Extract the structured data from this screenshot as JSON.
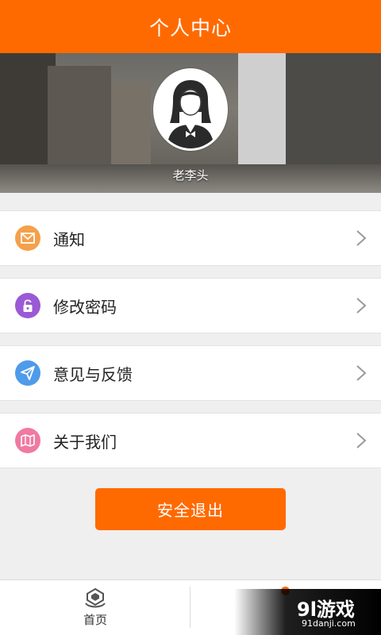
{
  "header": {
    "title": "个人中心"
  },
  "profile": {
    "name": "老李头"
  },
  "menu": [
    {
      "label": "通知",
      "icon": "mail-icon",
      "color": "#f5a04a"
    },
    {
      "label": "修改密码",
      "icon": "lock-icon",
      "color": "#9b59d6"
    },
    {
      "label": "意见与反馈",
      "icon": "send-icon",
      "color": "#4e9bea"
    },
    {
      "label": "关于我们",
      "icon": "map-icon",
      "color": "#f07aa1"
    }
  ],
  "logout": {
    "label": "安全退出"
  },
  "tabbar": {
    "home_label": "首页"
  },
  "watermark": {
    "logo": "9l游戏",
    "url": "91danji.com"
  },
  "colors": {
    "accent": "#ff6a00"
  }
}
